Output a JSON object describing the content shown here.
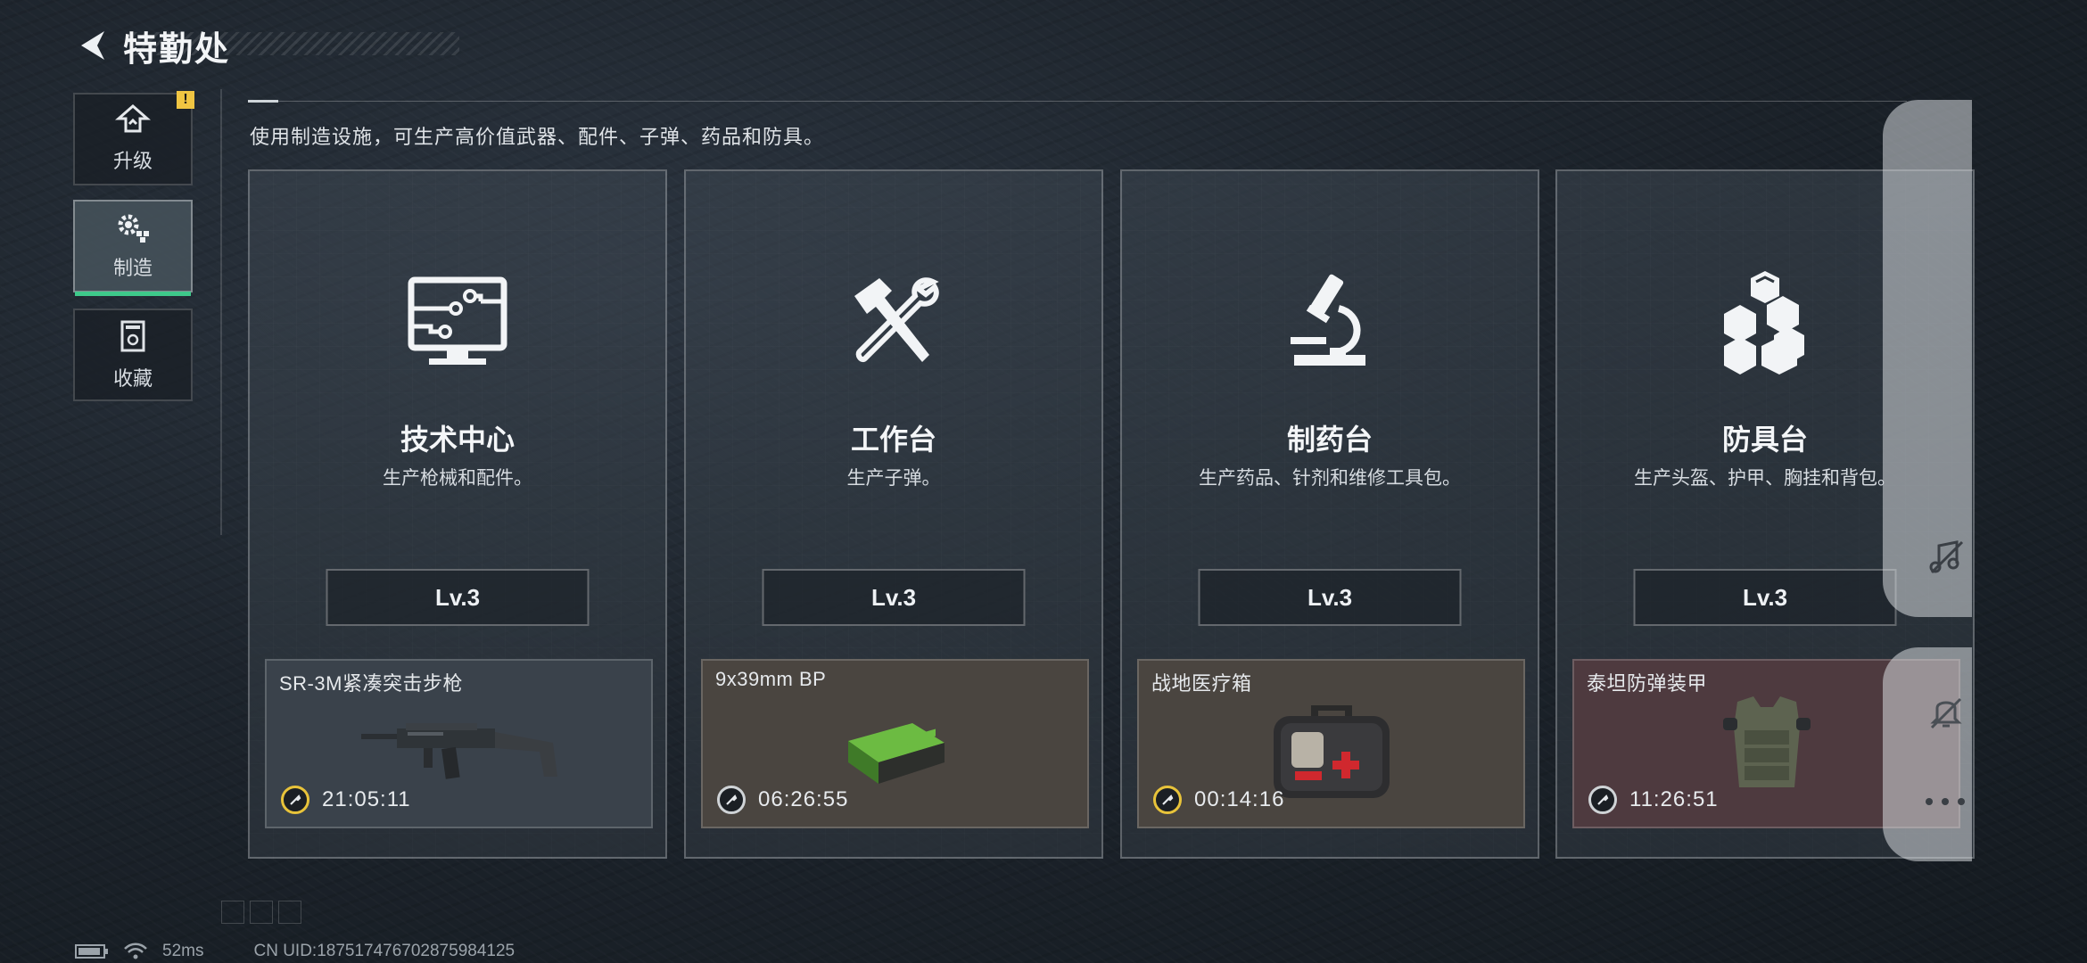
{
  "header": {
    "title": "特勤处",
    "back_icon": "back-arrow-icon"
  },
  "tabs": [
    {
      "label": "升级",
      "icon": "upgrade-icon",
      "active": false,
      "badge": "!"
    },
    {
      "label": "制造",
      "icon": "gears-icon",
      "active": true
    },
    {
      "label": "收藏",
      "icon": "collection-icon",
      "active": false
    }
  ],
  "description": "使用制造设施，可生产高价值武器、配件、子弹、药品和防具。",
  "stations": [
    {
      "name": "技术中心",
      "subtitle": "生产枪械和配件。",
      "level": "Lv.3",
      "icon": "monitor-icon",
      "production": {
        "item": "SR-3M紧凑突击步枪",
        "timer": "21:05:11",
        "bg": "#3a424b"
      }
    },
    {
      "name": "工作台",
      "subtitle": "生产子弹。",
      "level": "Lv.3",
      "icon": "hammer-wrench-icon",
      "production": {
        "item": "9x39mm BP",
        "timer": "06:26:55",
        "bg": "#4a4540"
      }
    },
    {
      "name": "制药台",
      "subtitle": "生产药品、针剂和维修工具包。",
      "level": "Lv.3",
      "icon": "microscope-icon",
      "production": {
        "item": "战地医疗箱",
        "timer": "00:14:16",
        "bg": "#4a4540"
      }
    },
    {
      "name": "防具台",
      "subtitle": "生产头盔、护甲、胸挂和背包。",
      "level": "Lv.3",
      "icon": "cubes-icon",
      "production": {
        "item": "泰坦防弹装甲",
        "timer": "11:26:51",
        "bg": "#4e3a3f"
      }
    }
  ],
  "side_menu": {
    "icons": [
      "music-off-icon",
      "bell-off-icon",
      "more-icon"
    ]
  },
  "status_bar": {
    "ping": "52ms",
    "uid": "CN UID:18751747670287598412​5"
  }
}
